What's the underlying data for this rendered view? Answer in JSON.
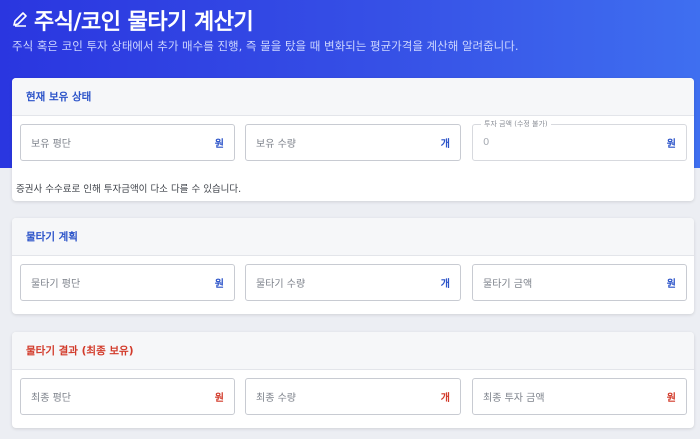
{
  "header": {
    "title": "주식/코인 물타기 계산기",
    "subtitle": "주식 혹은 코인 투자 상태에서 추가 매수를 진행, 즉 물을 탔을 때 변화되는 평균가격을 계산해 알려줍니다."
  },
  "current": {
    "title": "현재 보유 상태",
    "avg_price": {
      "placeholder": "보유 평단",
      "unit": "원"
    },
    "quantity": {
      "placeholder": "보유 수량",
      "unit": "개"
    },
    "amount": {
      "label": "투자 금액 (수정 불가)",
      "value": "0",
      "unit": "원"
    },
    "note": "증권사 수수료로 인해 투자금액이 다소 다를 수 있습니다."
  },
  "plan": {
    "title": "물타기 계획",
    "avg_price": {
      "placeholder": "물타기 평단",
      "unit": "원"
    },
    "quantity": {
      "placeholder": "물타기 수량",
      "unit": "개"
    },
    "amount": {
      "placeholder": "물타기 금액",
      "unit": "원"
    }
  },
  "result": {
    "title": "물타기 결과 (최종 보유)",
    "avg_price": {
      "placeholder": "최종 평단",
      "unit": "원"
    },
    "quantity": {
      "placeholder": "최종 수량",
      "unit": "개"
    },
    "amount": {
      "placeholder": "최종 투자 금액",
      "unit": "원"
    }
  },
  "icons": {
    "title_icon": "pencil-icon"
  },
  "colors": {
    "accent": "#2b53c9",
    "result": "#d23a2a",
    "hero": "#3045e4"
  }
}
